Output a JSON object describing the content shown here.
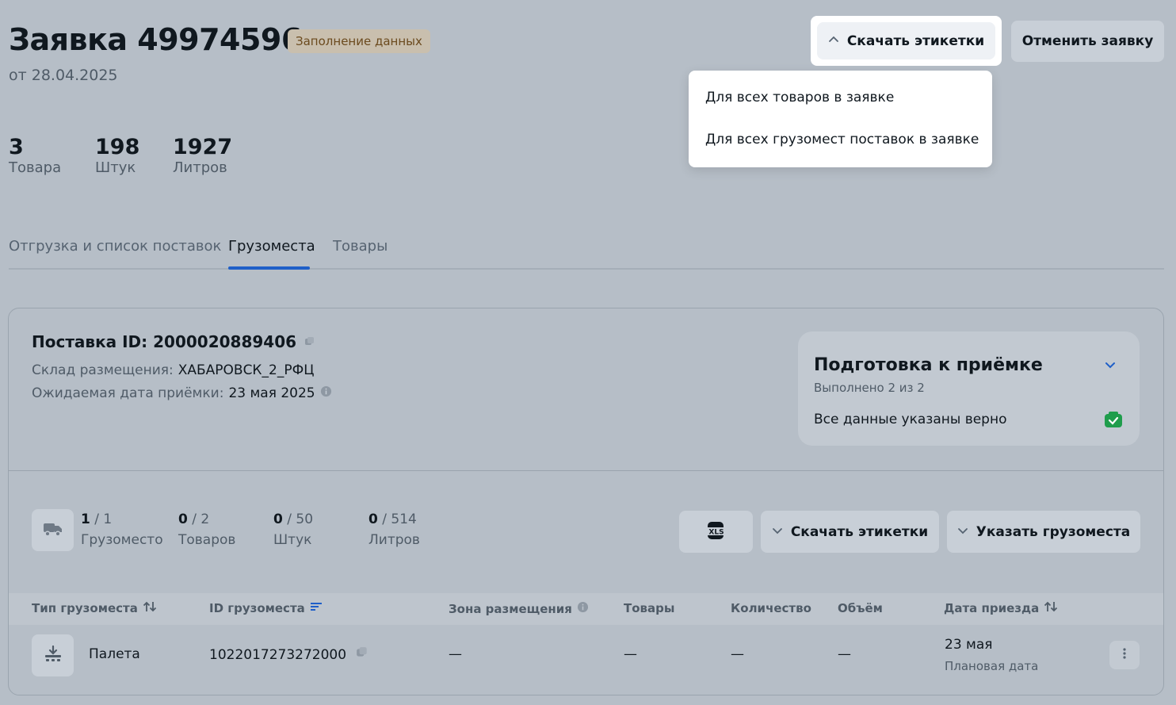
{
  "header": {
    "title": "Заявка 49974596",
    "status": "Заполнение данных",
    "date": "от 28.04.2025",
    "download_labels_button": "Скачать этикетки",
    "cancel_button": "Отменить заявку"
  },
  "dropdown": {
    "items": [
      "Для всех товаров в заявке",
      "Для всех грузомест поставок в заявке"
    ]
  },
  "stats": [
    {
      "value": "3",
      "label": "Товара"
    },
    {
      "value": "198",
      "label": "Штук"
    },
    {
      "value": "1927",
      "label": "Литров"
    }
  ],
  "tabs": [
    {
      "label": "Отгрузка и список поставок",
      "active": false
    },
    {
      "label": "Грузоместа",
      "active": true
    },
    {
      "label": "Товары",
      "active": false
    }
  ],
  "supply": {
    "id_label": "Поставка ID: 2000020889406",
    "warehouse_label": "Склад размещения:",
    "warehouse_value": "ХАБАРОВСК_2_РФЦ",
    "expected_label": "Ожидаемая дата приёмки:",
    "expected_value": "23 мая 2025"
  },
  "prep": {
    "title": "Подготовка к приёмке",
    "progress": "Выполнено 2 из 2",
    "row": "Все данные указаны верно"
  },
  "counters": [
    {
      "done": "1",
      "total": "/ 1",
      "label": "Грузоместо"
    },
    {
      "done": "0",
      "total": "/ 2",
      "label": "Товаров"
    },
    {
      "done": "0",
      "total": "/ 50",
      "label": "Штук"
    },
    {
      "done": "0",
      "total": "/ 514",
      "label": "Литров"
    }
  ],
  "actions": {
    "download_labels": "Скачать этикетки",
    "specify_places": "Указать грузоместа"
  },
  "table": {
    "columns": [
      "Тип грузоместа",
      "ID грузоместа",
      "Зона размещения",
      "Товары",
      "Количество",
      "Объём",
      "Дата приезда"
    ],
    "row": {
      "type": "Палета",
      "id": "1022017273272000",
      "zone": "—",
      "goods": "—",
      "qty": "—",
      "volume": "—",
      "date": "23 мая",
      "date_note": "Плановая дата"
    }
  },
  "colors": {
    "accent": "#1f5fc8",
    "success": "#1f9d4c",
    "background": "#b6bec7"
  }
}
